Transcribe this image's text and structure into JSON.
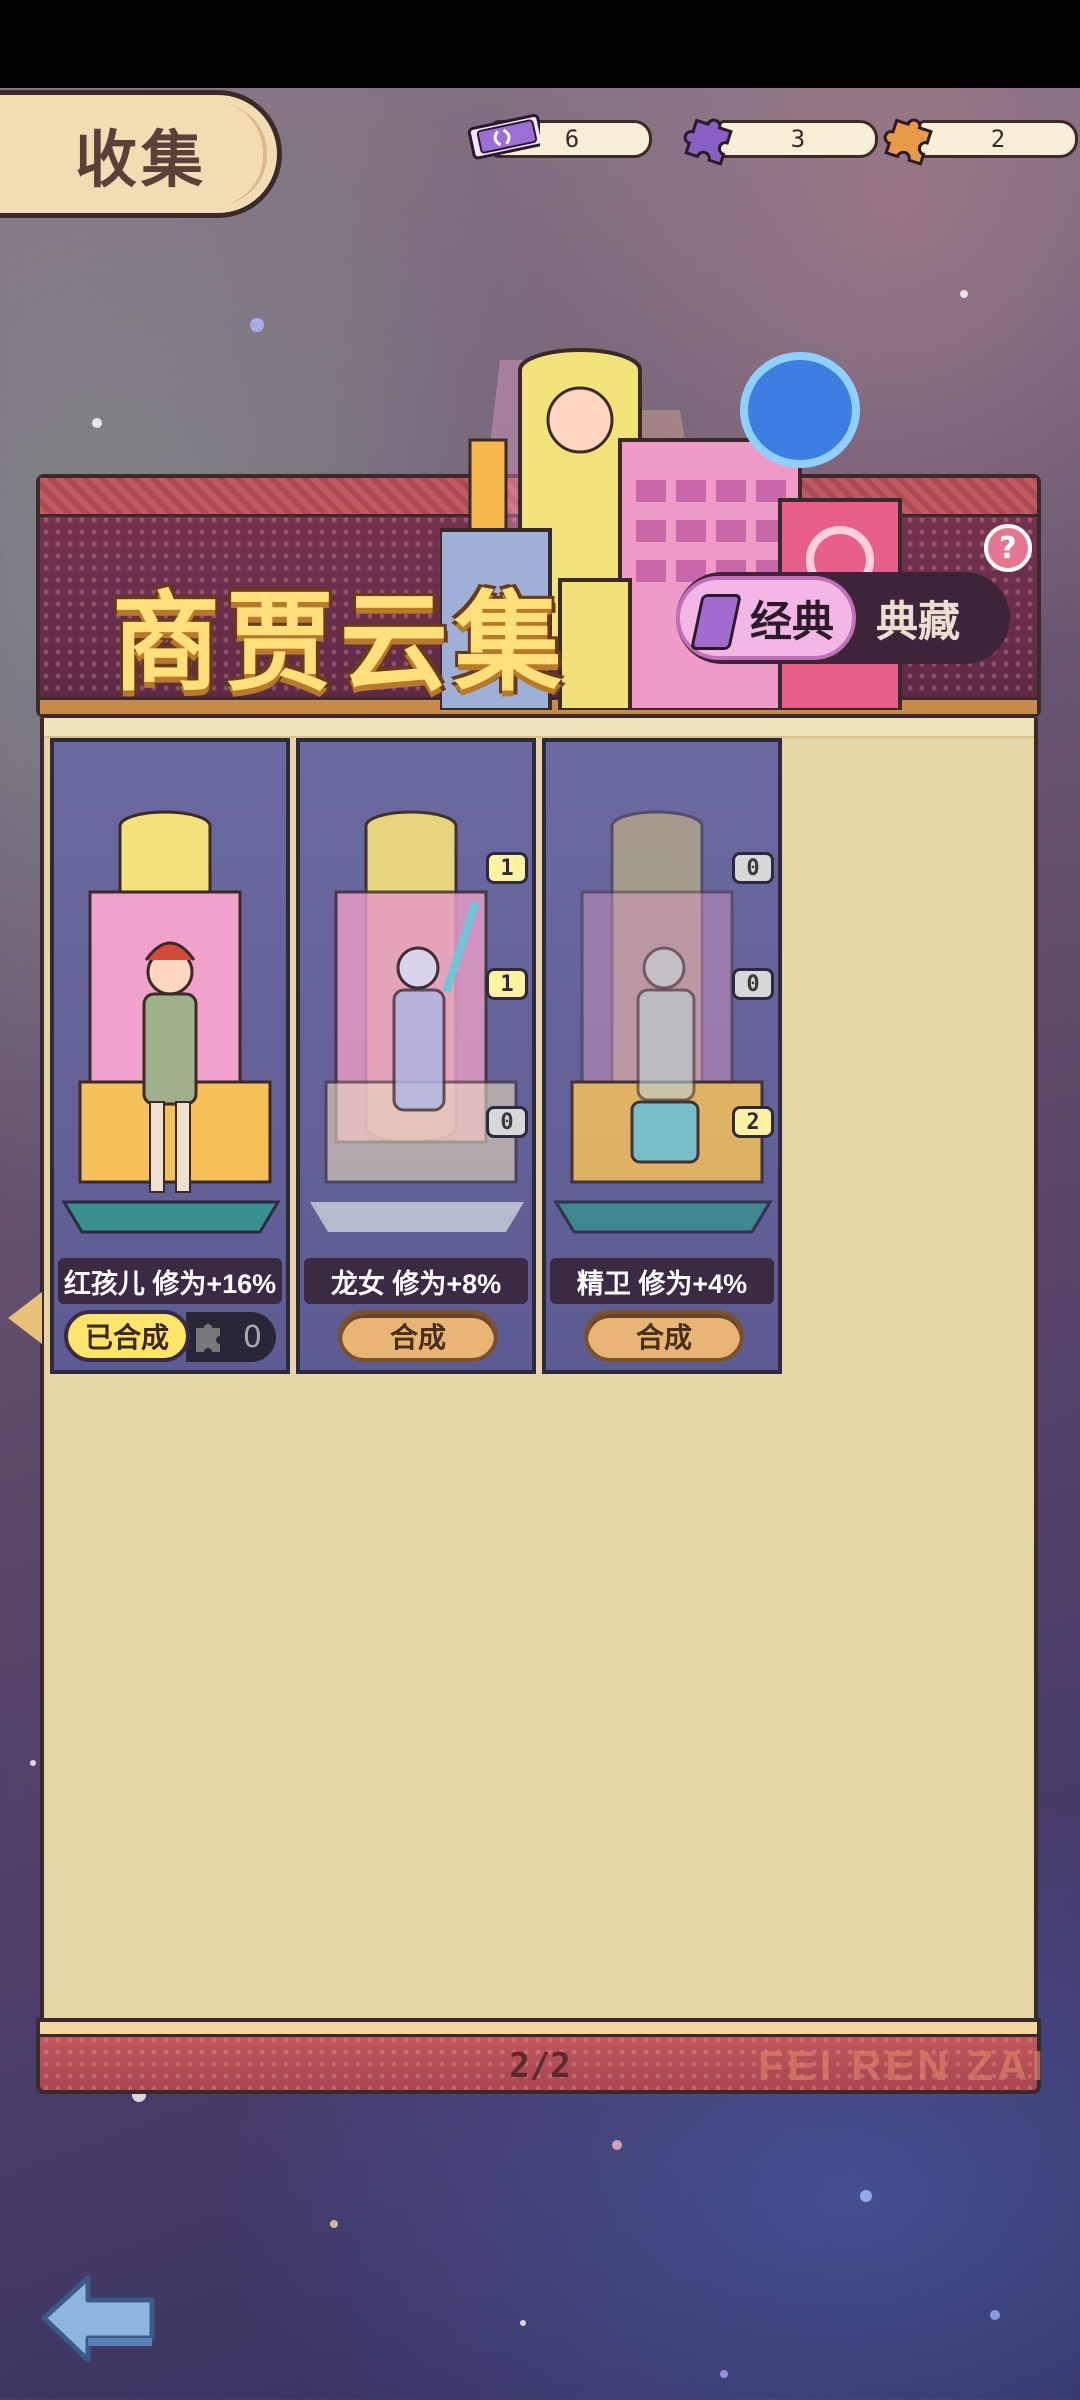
{
  "header": {
    "title": "收集",
    "currencies": [
      {
        "icon": "ticket-icon",
        "value": "6",
        "color": "#9b6fd6"
      },
      {
        "icon": "purple-puzzle-icon",
        "value": "3",
        "color": "#8a5fc4"
      },
      {
        "icon": "orange-puzzle-icon",
        "value": "2",
        "color": "#e89a4a"
      }
    ]
  },
  "banner": {
    "title": "商贾云集",
    "tab_active": "经典",
    "tab_inactive": "典藏",
    "help": "?"
  },
  "cards": [
    {
      "name": "红孩儿 修为+16%",
      "status": "已合成",
      "pieces": "0",
      "badges": []
    },
    {
      "name": "龙女  修为+8%",
      "button": "合成",
      "badges": [
        "1",
        "1",
        "0"
      ],
      "badge_states": [
        "on",
        "on",
        "off"
      ]
    },
    {
      "name": "精卫  修为+4%",
      "button": "合成",
      "badges": [
        "0",
        "0",
        "2"
      ],
      "badge_states": [
        "off",
        "off",
        "on"
      ]
    }
  ],
  "footer": {
    "page": "2/2",
    "watermark": "FEI REN ZAI"
  },
  "colors": {
    "panel": "#e6d6a6",
    "card": "#5d5c92",
    "button": "#e9b574",
    "done_button": "#ffe56a"
  }
}
